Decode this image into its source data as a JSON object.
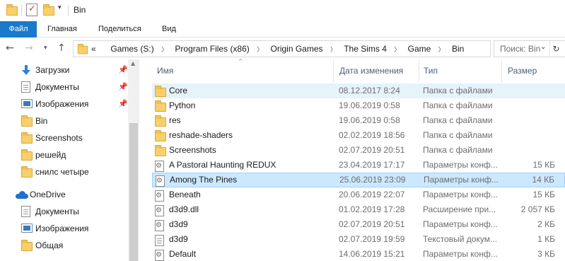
{
  "window": {
    "title": "Bin"
  },
  "ribbon": {
    "tabs": [
      "Файл",
      "Главная",
      "Поделиться",
      "Вид"
    ]
  },
  "address": {
    "overflow": "«",
    "crumbs": [
      "Games (S:)",
      "Program Files (x86)",
      "Origin Games",
      "The Sims 4",
      "Game",
      "Bin"
    ],
    "search_placeholder": "Поиск: Bin"
  },
  "nav": {
    "quick_access": [
      {
        "label": "Загрузки",
        "icon": "download-icon",
        "pinned": true
      },
      {
        "label": "Документы",
        "icon": "documents-icon",
        "pinned": true
      },
      {
        "label": "Изображения",
        "icon": "pictures-icon",
        "pinned": true
      },
      {
        "label": "Bin",
        "icon": "folder-icon",
        "pinned": false
      },
      {
        "label": "Screenshots",
        "icon": "folder-icon",
        "pinned": false
      },
      {
        "label": "решейд",
        "icon": "folder-icon",
        "pinned": false
      },
      {
        "label": "снилс четыре",
        "icon": "folder-icon",
        "pinned": false
      }
    ],
    "onedrive": {
      "label": "OneDrive",
      "icon": "cloud-icon"
    },
    "onedrive_items": [
      {
        "label": "Документы",
        "icon": "documents-icon"
      },
      {
        "label": "Изображения",
        "icon": "pictures-icon"
      },
      {
        "label": "Общая",
        "icon": "folder-icon"
      }
    ]
  },
  "columns": {
    "name": "Имя",
    "date": "Дата изменения",
    "type": "Тип",
    "size": "Размер"
  },
  "files": [
    {
      "name": "Core",
      "date": "08.12.2017 8:24",
      "type": "Папка с файлами",
      "size": "",
      "icon": "folder",
      "state": "hover"
    },
    {
      "name": "Python",
      "date": "19.06.2019 0:58",
      "type": "Папка с файлами",
      "size": "",
      "icon": "folder",
      "state": ""
    },
    {
      "name": "res",
      "date": "19.06.2019 0:58",
      "type": "Папка с файлами",
      "size": "",
      "icon": "folder",
      "state": ""
    },
    {
      "name": "reshade-shaders",
      "date": "02.02.2019 18:56",
      "type": "Папка с файлами",
      "size": "",
      "icon": "folder",
      "state": ""
    },
    {
      "name": "Screenshots",
      "date": "02.07.2019 20:51",
      "type": "Папка с файлами",
      "size": "",
      "icon": "folder",
      "state": ""
    },
    {
      "name": "A Pastoral Haunting REDUX",
      "date": "23.04.2019 17:17",
      "type": "Параметры конф...",
      "size": "15 КБ",
      "icon": "config",
      "state": ""
    },
    {
      "name": "Among The Pines",
      "date": "25.06.2019 23:09",
      "type": "Параметры конф...",
      "size": "14 КБ",
      "icon": "config",
      "state": "selected"
    },
    {
      "name": "Beneath",
      "date": "20.06.2019 22:07",
      "type": "Параметры конф...",
      "size": "15 КБ",
      "icon": "config",
      "state": ""
    },
    {
      "name": "d3d9.dll",
      "date": "01.02.2019 17:28",
      "type": "Расширение при...",
      "size": "2 057 КБ",
      "icon": "config",
      "state": ""
    },
    {
      "name": "d3d9",
      "date": "02.07.2019 20:51",
      "type": "Параметры конф...",
      "size": "2 КБ",
      "icon": "config",
      "state": ""
    },
    {
      "name": "d3d9",
      "date": "02.07.2019 19:59",
      "type": "Текстовый докум...",
      "size": "1 КБ",
      "icon": "text",
      "state": ""
    },
    {
      "name": "Default",
      "date": "14.06.2019 15:21",
      "type": "Параметры конф...",
      "size": "3 КБ",
      "icon": "config",
      "state": ""
    }
  ]
}
